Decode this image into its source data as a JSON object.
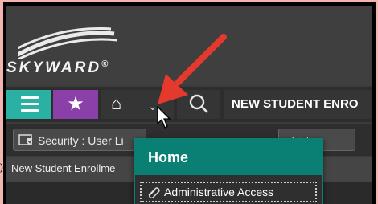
{
  "brand": {
    "name": "SKYWARD",
    "trademark": "®"
  },
  "navbar": {
    "menu_icon": "hamburger-icon",
    "favorites_icon": "star-icon",
    "home_icon": "home-icon",
    "chevron_icon": "chevron-down-icon",
    "search_icon": "search-icon",
    "title": "NEW STUDENT ENRO"
  },
  "tabs": [
    {
      "label": "Security : User Li",
      "icon": "shield-check-icon"
    },
    {
      "label": "e List"
    }
  ],
  "content": {
    "header": "New Student Enrollme"
  },
  "dropdown": {
    "title": "Home",
    "items": [
      {
        "label": "Administrative Access",
        "icon": "paperclip-icon"
      }
    ]
  },
  "overlay": {
    "annotation": "red-arrow",
    "cursor": "mouse-pointer"
  },
  "colors": {
    "teal": "#2bb1a3",
    "purple": "#8a3fa9",
    "dropdown_teal": "#0a7f73",
    "arrow_red": "#e5392d",
    "background_pink": "#f3b3ae"
  }
}
